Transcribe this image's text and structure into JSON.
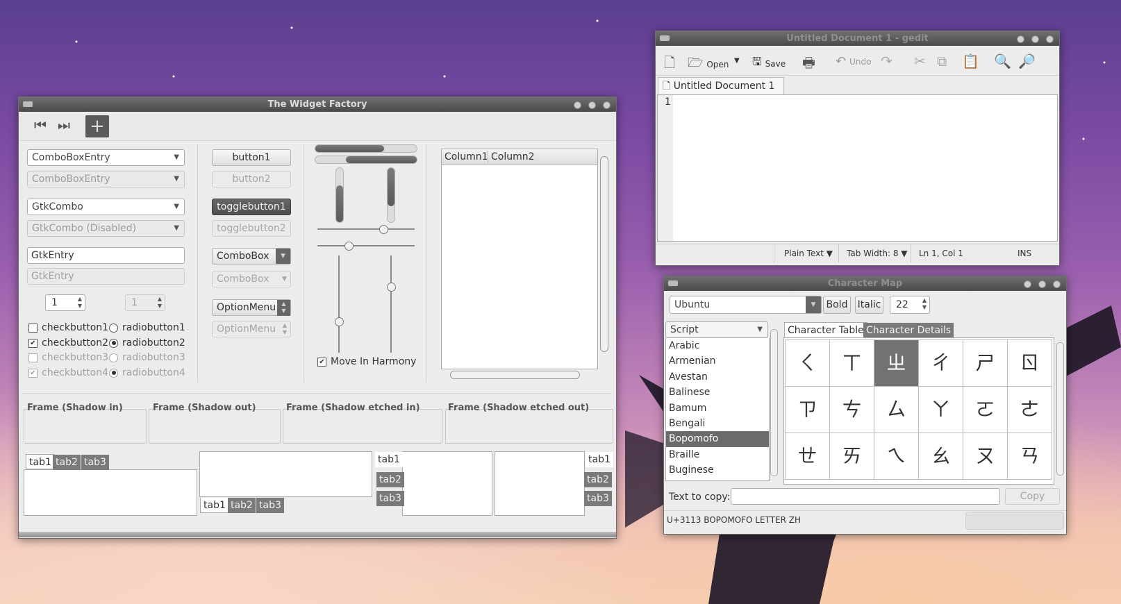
{
  "wf": {
    "title": "The Widget Factory",
    "combos": [
      "ComboBoxEntry",
      "ComboBoxEntry",
      "GtkCombo",
      "GtkCombo (Disabled)"
    ],
    "entries": [
      "GtkEntry",
      "GtkEntry"
    ],
    "spins": [
      "1",
      "1"
    ],
    "checks": [
      "checkbutton1",
      "checkbutton2",
      "checkbutton3",
      "checkbutton4"
    ],
    "radios": [
      "radiobutton1",
      "radiobutton2",
      "radiobutton3",
      "radiobutton4"
    ],
    "buttons": [
      "button1",
      "button2",
      "togglebutton1",
      "togglebutton2",
      "ComboBox",
      "ComboBox",
      "OptionMenu",
      "OptionMenu"
    ],
    "harmony": "Move In Harmony",
    "columns": [
      "Column1",
      "Column2"
    ],
    "frames": [
      "Frame (Shadow in)",
      "Frame (Shadow out)",
      "Frame (Shadow etched in)",
      "Frame (Shadow etched out)"
    ],
    "tabs": [
      "tab1",
      "tab2",
      "tab3"
    ],
    "progress": {
      "h1": 0.68,
      "h2": 0.7,
      "v1": 0.68,
      "v2": 0.7
    },
    "scales": {
      "h1": 0.68,
      "h2": 0.32,
      "v1": 0.68,
      "v2": 0.32
    }
  },
  "gedit": {
    "title": "Untitled Document 1 - gedit",
    "toolbar": {
      "open": "Open",
      "save": "Save",
      "undo": "Undo"
    },
    "tab": "Untitled Document 1",
    "line_number": "1",
    "status": {
      "lang": "Plain Text",
      "tabwidth": "Tab Width: 8",
      "pos": "Ln 1, Col 1",
      "mode": "INS"
    }
  },
  "charmap": {
    "title": "Character Map",
    "font": "Ubuntu",
    "bold": "Bold",
    "italic": "Italic",
    "size": "22",
    "script_header": "Script",
    "scripts": [
      "Arabic",
      "Armenian",
      "Avestan",
      "Balinese",
      "Bamum",
      "Bengali",
      "Bopomofo",
      "Braille",
      "Buginese"
    ],
    "selected_script": "Bopomofo",
    "tabs": [
      "Character Table",
      "Character Details"
    ],
    "chars": [
      "ㄑ",
      "ㄒ",
      "ㄓ",
      "ㄔ",
      "ㄕ",
      "ㄖ",
      "ㄗ",
      "ㄘ",
      "ㄙ",
      "ㄚ",
      "ㄛ",
      "ㄜ",
      "ㄝ",
      "ㄞ",
      "ㄟ",
      "ㄠ",
      "ㄡ",
      "ㄢ"
    ],
    "selected_char": "ㄓ",
    "text_to_copy_label": "Text to copy:",
    "copy_button": "Copy",
    "status": "U+3113 BOPOMOFO LETTER ZH"
  }
}
